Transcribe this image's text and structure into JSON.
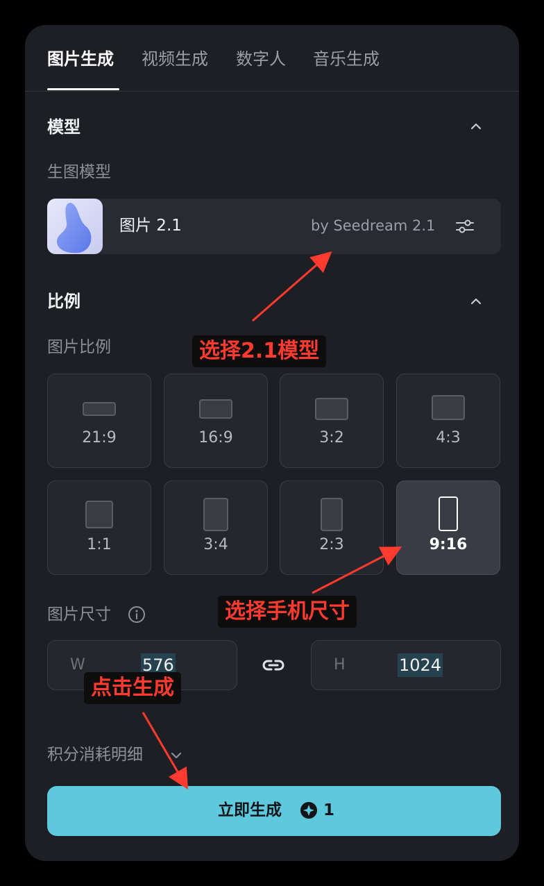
{
  "tabs": [
    {
      "label": "图片生成",
      "active": true
    },
    {
      "label": "视频生成",
      "active": false
    },
    {
      "label": "数字人",
      "active": false
    },
    {
      "label": "音乐生成",
      "active": false
    }
  ],
  "model_section": {
    "title": "模型",
    "subtitle": "生图模型",
    "model_name": "图片 2.1",
    "model_by": "by Seedream 2.1"
  },
  "ratio_section": {
    "title": "比例",
    "subtitle": "图片比例",
    "options": [
      {
        "label": "21:9",
        "selected": false
      },
      {
        "label": "16:9",
        "selected": false
      },
      {
        "label": "3:2",
        "selected": false
      },
      {
        "label": "4:3",
        "selected": false
      },
      {
        "label": "1:1",
        "selected": false
      },
      {
        "label": "3:4",
        "selected": false
      },
      {
        "label": "2:3",
        "selected": false
      },
      {
        "label": "9:16",
        "selected": true
      }
    ]
  },
  "size_section": {
    "label": "图片尺寸",
    "width_letter": "W",
    "width_value": "576",
    "height_letter": "H",
    "height_value": "1024"
  },
  "cost_detail_label": "积分消耗明细",
  "generate_button": {
    "label": "立即生成",
    "cost": "1"
  },
  "annotations": {
    "select_model": "选择2.1模型",
    "select_size": "选择手机尺寸",
    "click_generate": "点击生成"
  },
  "colors": {
    "panel_bg": "#1d1f24",
    "accent_button": "#5ec8dc",
    "annotation_red": "#ff3b2f"
  }
}
